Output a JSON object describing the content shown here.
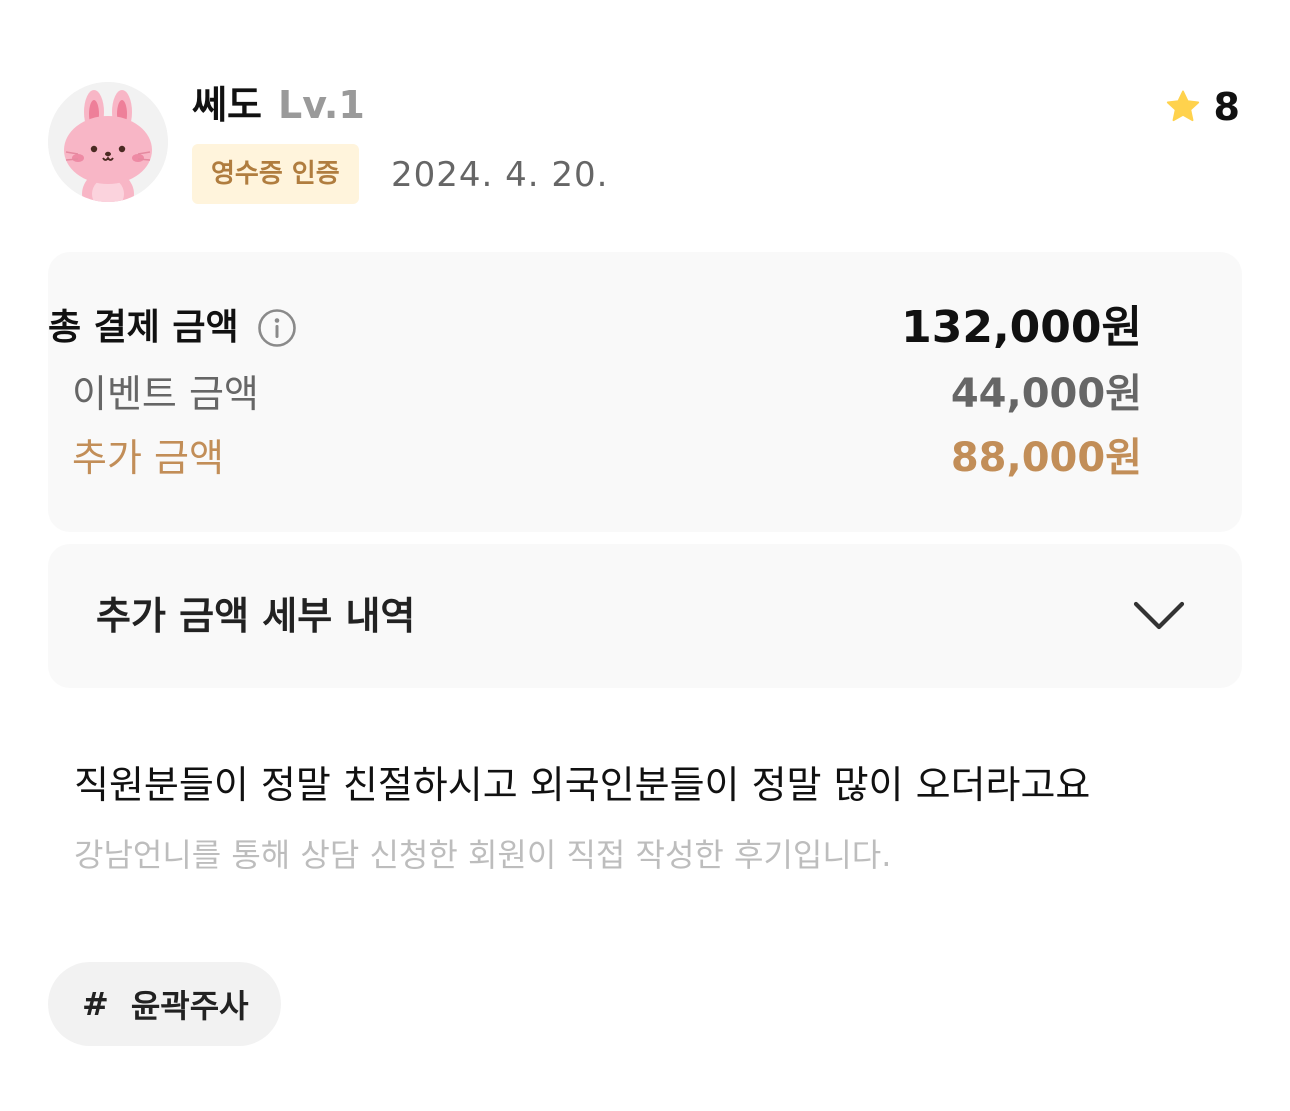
{
  "user": {
    "nickname": "쎄도",
    "level": "Lv.1",
    "avatar_icon": "pink-rabbit-avatar"
  },
  "rating": {
    "icon": "star-icon",
    "value": "8",
    "star_color": "#ffd24d"
  },
  "badge": {
    "label": "영수증 인증"
  },
  "date": "2024. 4. 20.",
  "price": {
    "total_label": "총 결제 금액",
    "total_value": "132,000원",
    "event_label": "이벤트 금액",
    "event_value": "44,000원",
    "extra_label": "추가 금액",
    "extra_value": "88,000원",
    "info_icon": "info-icon"
  },
  "accordion": {
    "title": "추가 금액 세부 내역",
    "icon": "chevron-down-icon"
  },
  "review": {
    "text": "직원분들이 정말 친절하시고 외국인분들이 정말 많이 오더라고요",
    "disclaimer": "강남언니를 통해 상담 신청한 회원이 직접 작성한 후기입니다."
  },
  "tags": [
    {
      "hash": "#",
      "label": "윤곽주사"
    }
  ],
  "colors": {
    "accent_brown": "#c28e58",
    "badge_bg": "#fff4dc",
    "card_bg": "#f9f9f9"
  }
}
